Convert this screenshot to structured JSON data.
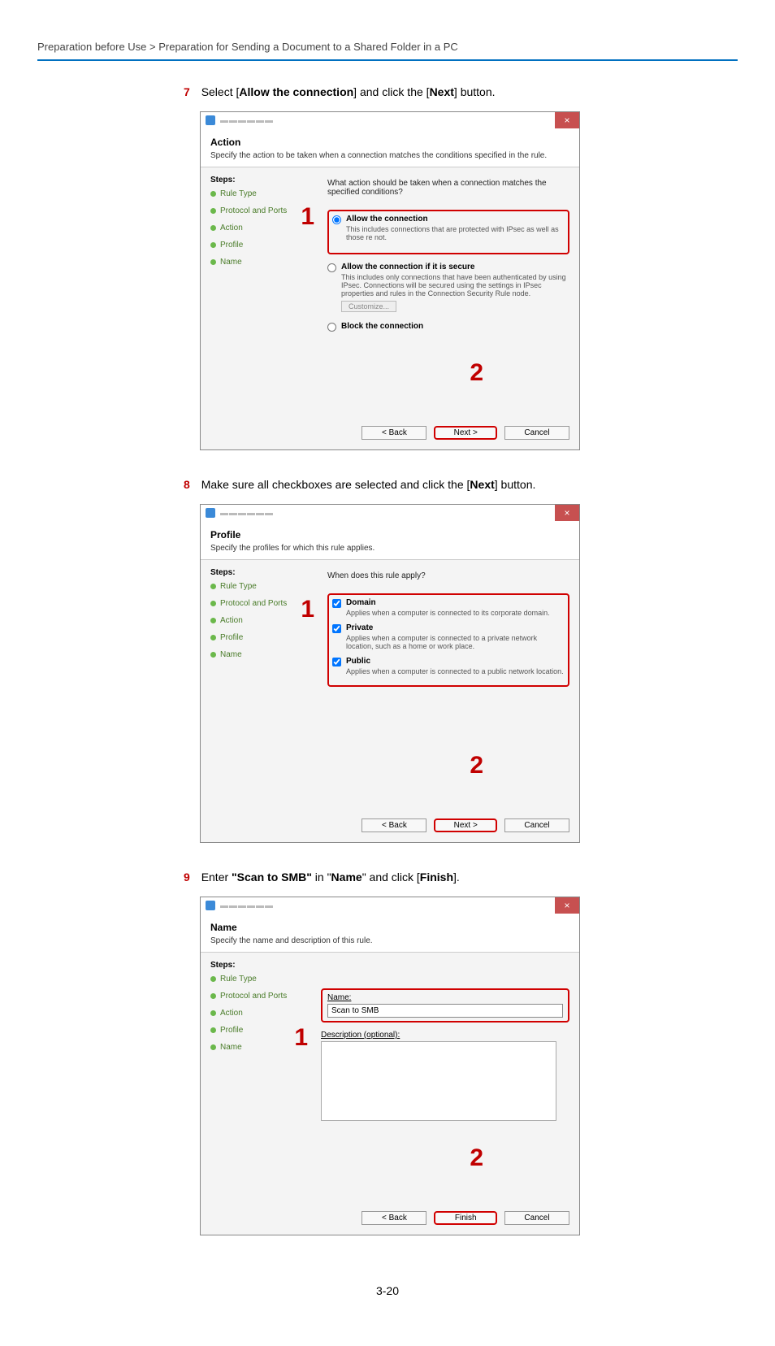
{
  "breadcrumb": "Preparation before Use > Preparation for Sending a Document to a Shared Folder in a PC",
  "step7": {
    "num": "7",
    "text_a": "Select [",
    "text_b": "Allow the connection",
    "text_c": "] and click the [",
    "text_d": "Next",
    "text_e": "] button."
  },
  "step8": {
    "num": "8",
    "text_a": "Make sure all checkboxes are selected and click the [",
    "text_b": "Next",
    "text_c": "] button."
  },
  "step9": {
    "num": "9",
    "text_a": "Enter ",
    "text_b": "\"Scan to SMB\"",
    "text_c": " in \"",
    "text_d": "Name",
    "text_e": "\" and click [",
    "text_f": "Finish",
    "text_g": "]."
  },
  "dialog_common": {
    "steps_heading": "Steps:",
    "step_rule_type": "Rule Type",
    "step_protocol": "Protocol and Ports",
    "step_action": "Action",
    "step_profile": "Profile",
    "step_name": "Name",
    "back": "< Back",
    "next": "Next >",
    "finish": "Finish",
    "cancel": "Cancel",
    "close": "×",
    "num1": "1",
    "num2": "2"
  },
  "dlg_action": {
    "title": "Action",
    "subtitle": "Specify the action to be taken when a connection matches the conditions specified in the rule.",
    "question": "What action should be taken when a connection matches the specified conditions?",
    "opt1_label": "Allow the connection",
    "opt1_desc_a": "This includes connections that are protected with IPsec as well as those ",
    "opt1_desc_b": "re not.",
    "opt2_label": "Allow the connection if it is secure",
    "opt2_desc": "This includes only connections that have been authenticated by using IPsec. Connections will be secured using the settings in IPsec properties and rules in the Connection Security Rule node.",
    "customize": "Customize...",
    "opt3_label": "Block the connection"
  },
  "dlg_profile": {
    "title": "Profile",
    "subtitle": "Specify the profiles for which this rule applies.",
    "question": "When does this rule apply?",
    "chk1_label": "Domain",
    "chk1_desc": "Applies when a computer is connected to its corporate domain.",
    "chk2_label": "Private",
    "chk2_desc": "Applies when a computer is connected to a private network location, such as a home or work place.",
    "chk3_label": "Public",
    "chk3_desc": "Applies when a computer is connected to a public network location."
  },
  "dlg_name": {
    "title": "Name",
    "subtitle": "Specify the name and description of this rule.",
    "name_label": "Name:",
    "name_value": "Scan to SMB",
    "desc_label": "Description (optional):"
  },
  "page_number": "3-20"
}
